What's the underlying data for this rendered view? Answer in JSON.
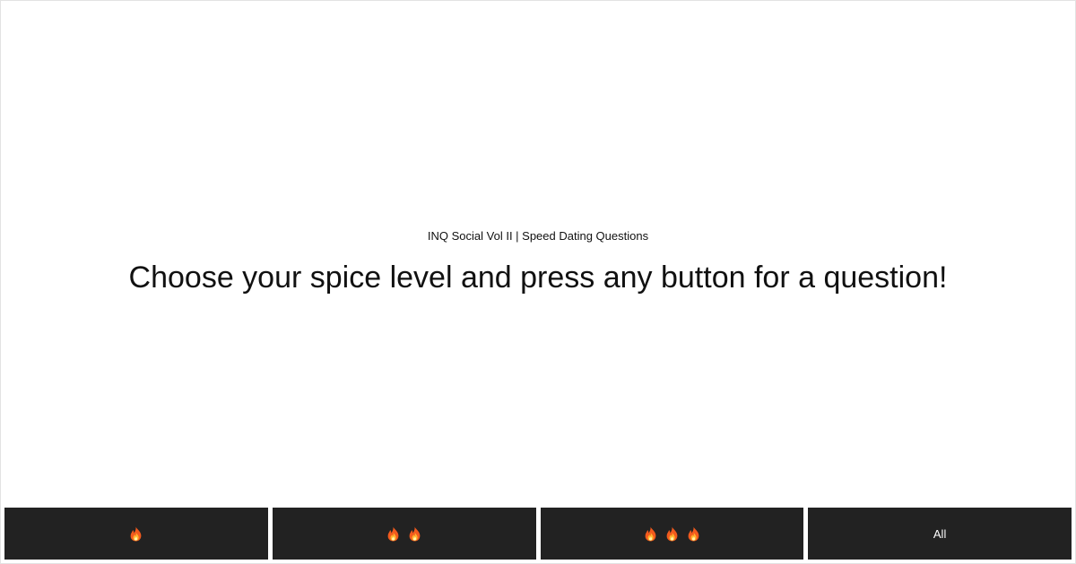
{
  "header": {
    "subtitle": "INQ Social Vol II | Speed Dating Questions",
    "headline": "Choose your spice level and press any button for a question!"
  },
  "buttons": [
    {
      "flame_count": 1,
      "icon": "fire-icon"
    },
    {
      "flame_count": 2,
      "icon": "fire-icon"
    },
    {
      "flame_count": 3,
      "icon": "fire-icon"
    },
    {
      "label": "All"
    }
  ],
  "colors": {
    "background": "#ffffff",
    "button_bg": "#222222",
    "button_text": "#ffffff",
    "text": "#111111"
  }
}
